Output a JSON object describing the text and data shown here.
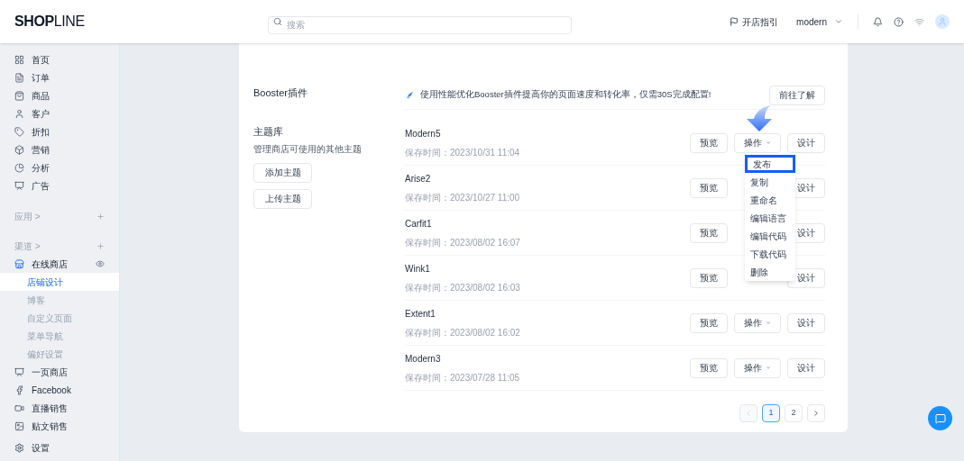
{
  "header": {
    "logo_bold": "SHOP",
    "logo_light": "LINE",
    "search": {
      "placeholder": "搜索"
    },
    "guide": "开店指引",
    "store": "modern"
  },
  "sidebar": {
    "main": [
      {
        "label": "首页"
      },
      {
        "label": "订单"
      },
      {
        "label": "商品"
      },
      {
        "label": "客户"
      },
      {
        "label": "折扣"
      },
      {
        "label": "营销"
      },
      {
        "label": "分析"
      },
      {
        "label": "广告"
      }
    ],
    "apps": "应用 >",
    "channels": "渠道 >",
    "store": {
      "label": "在线商店",
      "expanded": true,
      "children": [
        {
          "label": "店铺设计",
          "selected": true
        },
        {
          "label": "博客",
          "selected": false
        },
        {
          "label": "自定义页面",
          "selected": false
        },
        {
          "label": "菜单导航",
          "selected": false
        },
        {
          "label": "偏好设置",
          "selected": false
        }
      ]
    },
    "more": [
      {
        "label": "一页商店"
      },
      {
        "label": "Facebook"
      },
      {
        "label": "直播销售"
      },
      {
        "label": "贴文销售"
      }
    ],
    "settings": "设置"
  },
  "booster": {
    "title": "Booster插件",
    "text": "使用性能优化Booster插件提高你的页面速度和转化率，仅需30S完成配置!",
    "button": "前往了解"
  },
  "library": {
    "title": "主题库",
    "subtitle": "管理商店可使用的其他主题",
    "buttons": [
      "添加主题",
      "上传主题"
    ],
    "themes": [
      {
        "name": "Modern5",
        "saved": "保存时间：2023/10/31 11:04",
        "preview": "预览",
        "operate": "操作",
        "design": "设计"
      },
      {
        "name": "Arise2",
        "saved": "保存时间：2023/10/27 11:00",
        "preview": "预览",
        "design": "设计"
      },
      {
        "name": "Carfit1",
        "saved": "保存时间：2023/08/02 16:07",
        "preview": "预览",
        "design": "设计"
      },
      {
        "name": "Wink1",
        "saved": "保存时间：2023/08/02 16:03",
        "preview": "预览",
        "design": "设计"
      },
      {
        "name": "Extent1",
        "saved": "保存时间：2023/08/02 16:02",
        "preview": "预览",
        "operate": "操作",
        "design": "设计"
      },
      {
        "name": "Modern3",
        "saved": "保存时间：2023/07/28 11:05",
        "preview": "预览",
        "operate": "操作",
        "design": "设计"
      }
    ],
    "menu": [
      {
        "label": "发布",
        "highlighted": true
      },
      {
        "label": "复制",
        "highlighted": false
      },
      {
        "label": "重命名",
        "highlighted": false
      },
      {
        "label": "编辑语言",
        "highlighted": false
      },
      {
        "label": "编辑代码",
        "highlighted": false
      },
      {
        "label": "下载代码",
        "highlighted": false
      },
      {
        "label": "删除",
        "highlighted": false
      }
    ]
  },
  "pagination": [
    {
      "label": "1",
      "selected": true
    },
    {
      "label": "2",
      "selected": false
    }
  ]
}
